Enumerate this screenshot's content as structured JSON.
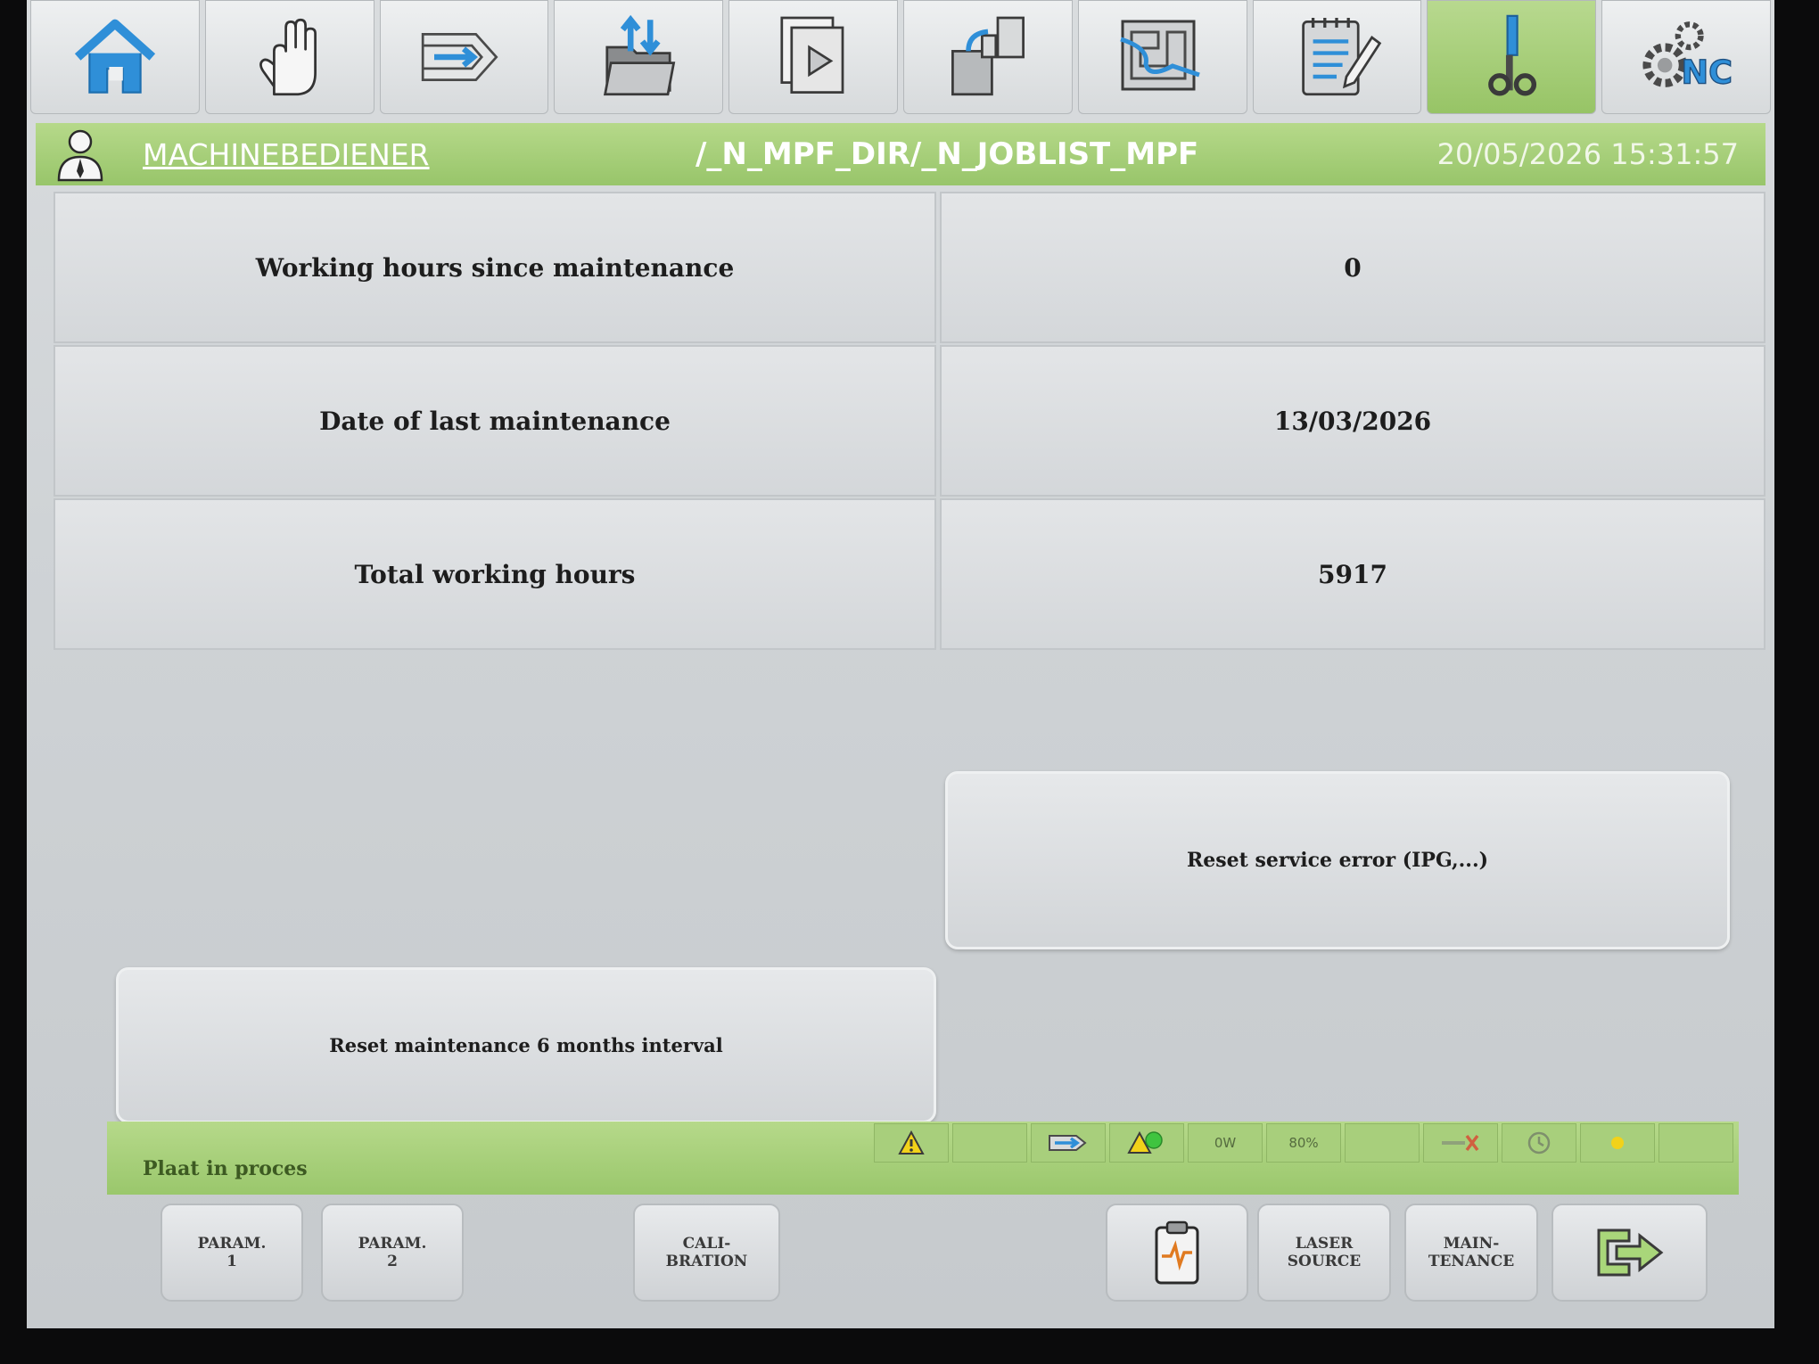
{
  "toolbar": {
    "items": [
      {
        "icon": "home-icon"
      },
      {
        "icon": "hand-icon"
      },
      {
        "icon": "arrow-right-icon"
      },
      {
        "icon": "folder-transfer-icon"
      },
      {
        "icon": "documents-play-icon"
      },
      {
        "icon": "parts-icon"
      },
      {
        "icon": "path-icon"
      },
      {
        "icon": "notepad-edit-icon"
      },
      {
        "icon": "tools-icon",
        "active": true
      },
      {
        "icon": "nc-gear-icon",
        "label": "NC"
      }
    ]
  },
  "header": {
    "user": "MACHINEBEDIENER",
    "path": "/_N_MPF_DIR/_N_JOBLIST_MPF",
    "datetime": "20/05/2026 15:31:57"
  },
  "maintenance": {
    "rows": [
      {
        "label": "Working hours since maintenance",
        "value": "0"
      },
      {
        "label": "Date of last maintenance",
        "value": "13/03/2026"
      },
      {
        "label": "Total working hours",
        "value": "5917"
      }
    ]
  },
  "actions": {
    "reset_service_error": "Reset service error (IPG,...)",
    "reset_maintenance": "Reset maintenance 6 months interval"
  },
  "status": {
    "message": "Plaat in proces",
    "power": "0W",
    "percent": "80%"
  },
  "softkeys": {
    "param1": "PARAM.\n1",
    "param2": "PARAM.\n2",
    "calibration": "CALI-\nBRATION",
    "laser_source": "LASER\nSOURCE",
    "maintenance": "MAIN-\nTENANCE"
  },
  "colors": {
    "accent_green": "#98c56a",
    "icon_blue": "#2f8fd8"
  }
}
